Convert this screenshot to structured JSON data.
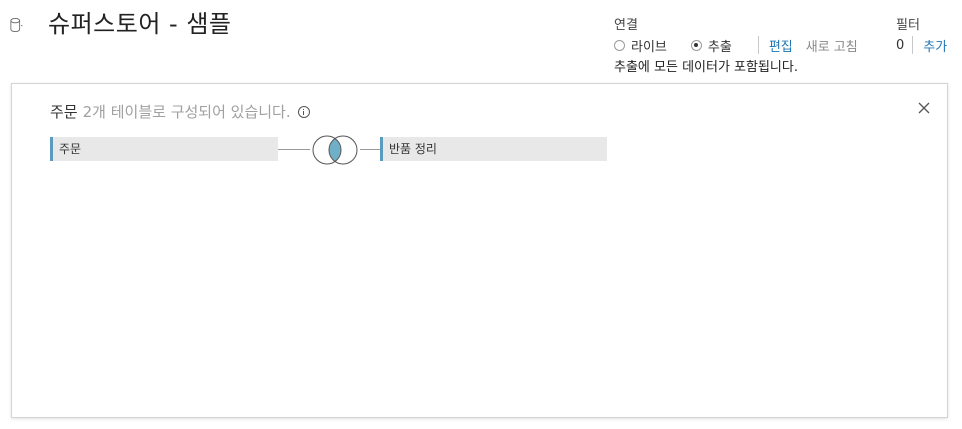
{
  "header": {
    "title": "슈퍼스토어 - 샘플",
    "icon": "database-icon"
  },
  "connection": {
    "label": "연결",
    "options": [
      {
        "label": "라이브",
        "selected": false
      },
      {
        "label": "추출",
        "selected": true
      }
    ],
    "edit_label": "편집",
    "refresh_label": "새로 고침",
    "note": "추출에 모든 데이터가 포함됩니다."
  },
  "filters": {
    "label": "필터",
    "count": "0",
    "add_label": "추가"
  },
  "canvas": {
    "summary": {
      "table": "주문",
      "description": "2개 테이블로 구성되어 있습니다."
    },
    "tables": {
      "left": "주문",
      "right": "반품 정리"
    },
    "join_type": "inner",
    "colors": {
      "accent": "#5b9bbf",
      "join_fill": "#6fb0c8",
      "link": "#1f77b4"
    }
  }
}
